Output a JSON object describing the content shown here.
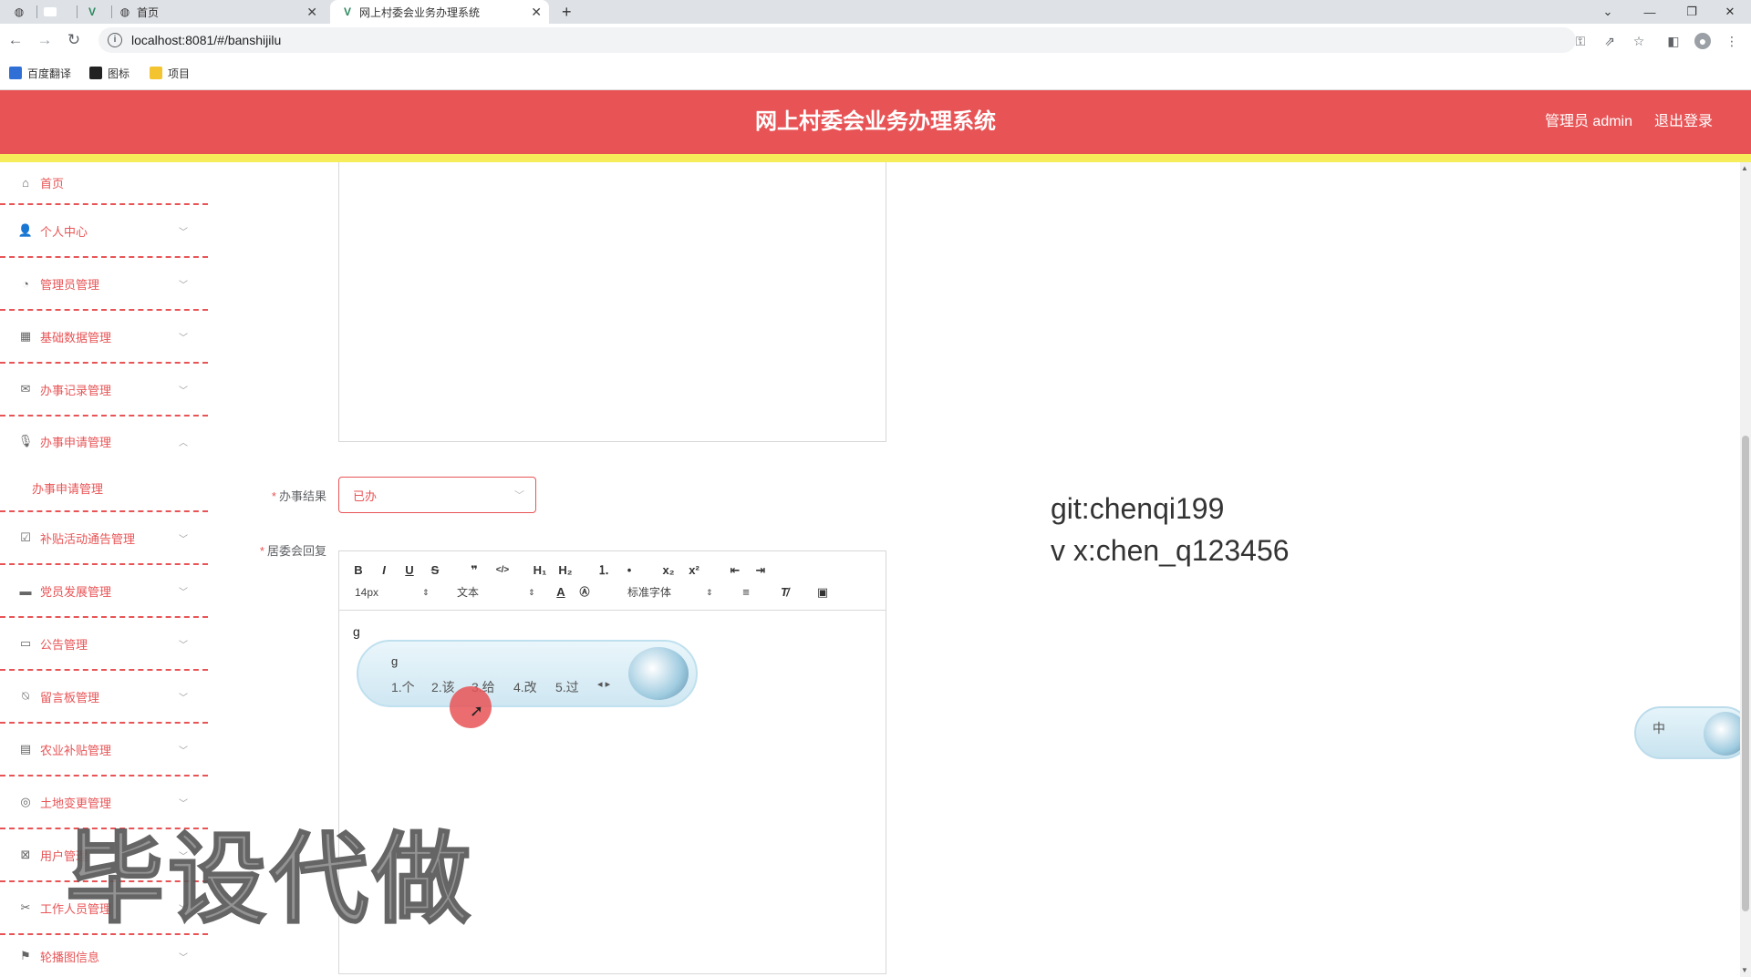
{
  "browser": {
    "tabs": [
      {
        "label": "首页",
        "active": false
      },
      {
        "label": "网上村委会业务办理系统",
        "active": true
      }
    ],
    "new_tab_symbol": "+",
    "url": "localhost:8081/#/banshijilu",
    "bookmarks": [
      {
        "label": "百度翻译",
        "color": "#2f6fd6"
      },
      {
        "label": "图标",
        "color": "#222222"
      },
      {
        "label": "项目",
        "color": "#f4c430"
      }
    ]
  },
  "header": {
    "title": "网上村委会业务办理系统",
    "user_label": "管理员 admin",
    "logout_label": "退出登录",
    "bg_color": "#e85456",
    "accent_bar_color": "#f5ee5a"
  },
  "sidebar": {
    "items": [
      {
        "label": "首页",
        "icon": "home-icon",
        "chevron": ""
      },
      {
        "label": "个人中心",
        "icon": "user-icon",
        "chevron": "﹀"
      },
      {
        "label": "管理员管理",
        "icon": "gauge-icon",
        "chevron": "﹀"
      },
      {
        "label": "基础数据管理",
        "icon": "grid-icon",
        "chevron": "﹀"
      },
      {
        "label": "办事记录管理",
        "icon": "mail-icon",
        "chevron": "﹀"
      },
      {
        "label": "办事申请管理",
        "icon": "mic-icon",
        "chevron": "︿"
      },
      {
        "label": "办事申请管理",
        "icon": "",
        "chevron": ""
      },
      {
        "label": "补贴活动通告管理",
        "icon": "clipboard-check-icon",
        "chevron": "﹀"
      },
      {
        "label": "党员发展管理",
        "icon": "monitor-icon",
        "chevron": "﹀"
      },
      {
        "label": "公告管理",
        "icon": "chat-icon",
        "chevron": "﹀"
      },
      {
        "label": "留言板管理",
        "icon": "bell-off-icon",
        "chevron": "﹀"
      },
      {
        "label": "农业补贴管理",
        "icon": "clipboard-icon",
        "chevron": "﹀"
      },
      {
        "label": "土地变更管理",
        "icon": "target-icon",
        "chevron": "﹀"
      },
      {
        "label": "用户管理",
        "icon": "clipboard-x-icon",
        "chevron": "﹀"
      },
      {
        "label": "工作人员管理",
        "icon": "ticket-icon",
        "chevron": "﹀"
      },
      {
        "label": "轮播图信息",
        "icon": "flag-icon",
        "chevron": "﹀"
      }
    ]
  },
  "form": {
    "result_label": "办事结果",
    "result_value": "已办",
    "reply_label": "居委会回复",
    "required_mark": "*"
  },
  "editor": {
    "toolbar_row1": [
      "B",
      "I",
      "U",
      "S",
      "❞",
      "</>",
      "H₁",
      "H₂",
      "⒈",
      "•",
      "x₂",
      "x²",
      "⇤",
      "⇥"
    ],
    "font_size": "14px",
    "text_type": "文本",
    "font_family": "标准字体",
    "content": "g"
  },
  "ime": {
    "input": "g",
    "candidates": [
      "1.个",
      "2.该",
      "3.给",
      "4.改",
      "5.过"
    ],
    "nav": "◂ ▸",
    "float_label": "中"
  },
  "overlay": {
    "git_line": "git:chenqi199",
    "vx_line": "v x:chen_q123456",
    "watermark": "毕设代做"
  }
}
